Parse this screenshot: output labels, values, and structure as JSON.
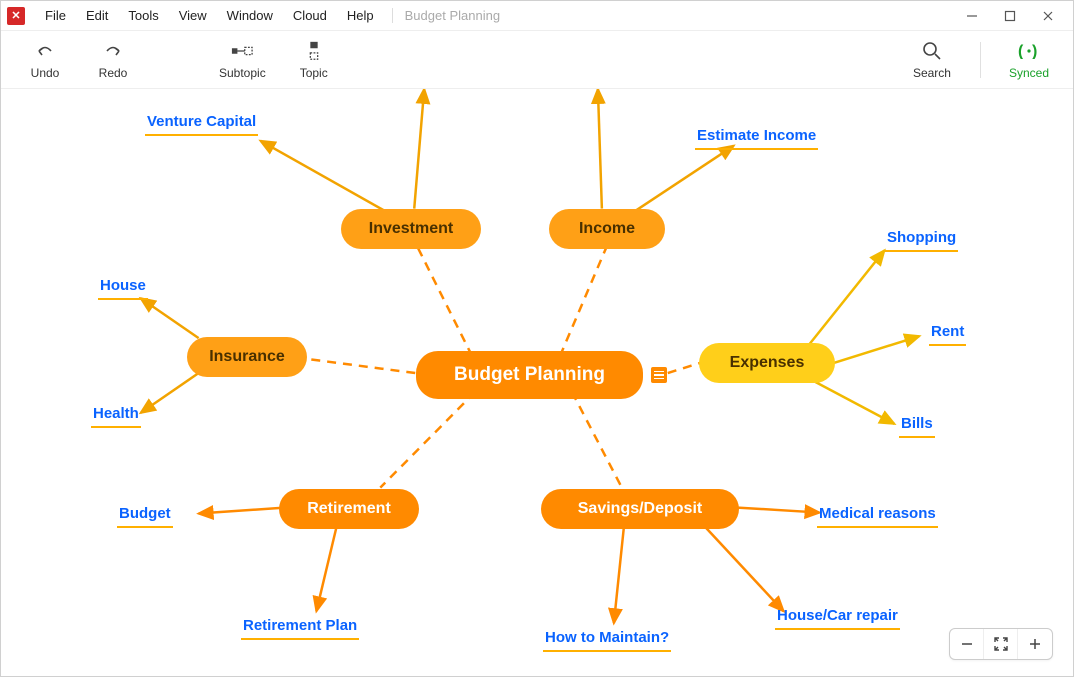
{
  "menu": {
    "items": [
      "File",
      "Edit",
      "Tools",
      "View",
      "Window",
      "Cloud",
      "Help"
    ],
    "doc_title": "Budget Planning"
  },
  "toolbar": {
    "undo": "Undo",
    "redo": "Redo",
    "subtopic": "Subtopic",
    "topic": "Topic",
    "search": "Search",
    "synced": "Synced"
  },
  "mindmap": {
    "center": "Budget Planning",
    "branches": {
      "investment": {
        "label": "Investment",
        "leaves": [
          "Venture Capital"
        ]
      },
      "income": {
        "label": "Income",
        "leaves": [
          "Estimate Income"
        ]
      },
      "insurance": {
        "label": "Insurance",
        "leaves": [
          "House",
          "Health"
        ]
      },
      "expenses": {
        "label": "Expenses",
        "leaves": [
          "Shopping",
          "Rent",
          "Bills"
        ]
      },
      "retirement": {
        "label": "Retirement",
        "leaves": [
          "Budget",
          "Retirement Plan"
        ]
      },
      "savings": {
        "label": "Savings/Deposit",
        "leaves": [
          "Medical reasons",
          "House/Car repair",
          "How to Maintain?"
        ]
      }
    }
  },
  "colors": {
    "accent_orange": "#ff8a00",
    "accent_yellow": "#ffcf1a",
    "link_blue": "#0a63ff",
    "sync_green": "#1aa12a"
  }
}
